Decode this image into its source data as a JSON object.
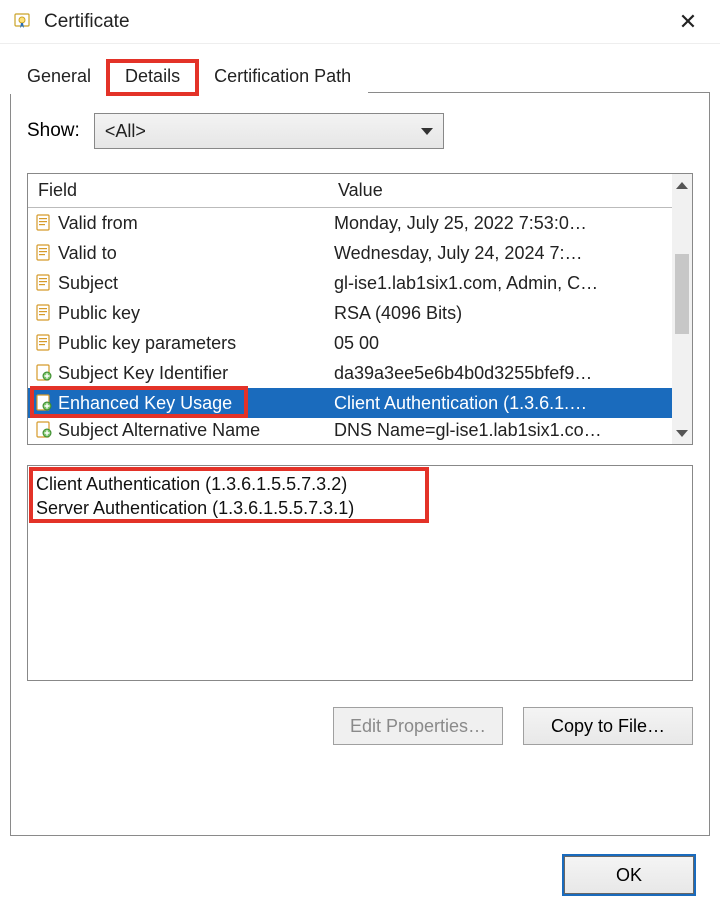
{
  "window": {
    "title": "Certificate",
    "close_glyph": "✕"
  },
  "tabs": [
    {
      "label": "General",
      "active": false
    },
    {
      "label": "Details",
      "active": true,
      "highlighted": true
    },
    {
      "label": "Certification Path",
      "active": false
    }
  ],
  "show": {
    "label": "Show:",
    "value": "<All>"
  },
  "columns": {
    "field": "Field",
    "value": "Value"
  },
  "fields": [
    {
      "icon": "doc",
      "field": "Valid from",
      "value": "Monday, July 25, 2022 7:53:0…"
    },
    {
      "icon": "doc",
      "field": "Valid to",
      "value": "Wednesday, July 24, 2024 7:…"
    },
    {
      "icon": "doc",
      "field": "Subject",
      "value": "gl-ise1.lab1six1.com, Admin, C…"
    },
    {
      "icon": "doc",
      "field": "Public key",
      "value": "RSA (4096 Bits)"
    },
    {
      "icon": "doc",
      "field": "Public key parameters",
      "value": "05 00"
    },
    {
      "icon": "ext",
      "field": "Subject Key Identifier",
      "value": "da39a3ee5e6b4b0d3255bfef9…"
    },
    {
      "icon": "ext",
      "field": "Enhanced Key Usage",
      "value": "Client Authentication (1.3.6.1.…",
      "selected": true,
      "row_highlighted": true
    },
    {
      "icon": "ext",
      "field": "Subject Alternative Name",
      "value": "DNS Name=gl-ise1.lab1six1.co…",
      "partial": true
    }
  ],
  "detail_lines": [
    "Client Authentication (1.3.6.1.5.5.7.3.2)",
    "Server Authentication (1.3.6.1.5.5.7.3.1)"
  ],
  "buttons": {
    "edit_properties": "Edit Properties…",
    "copy_to_file": "Copy to File…",
    "ok": "OK"
  }
}
